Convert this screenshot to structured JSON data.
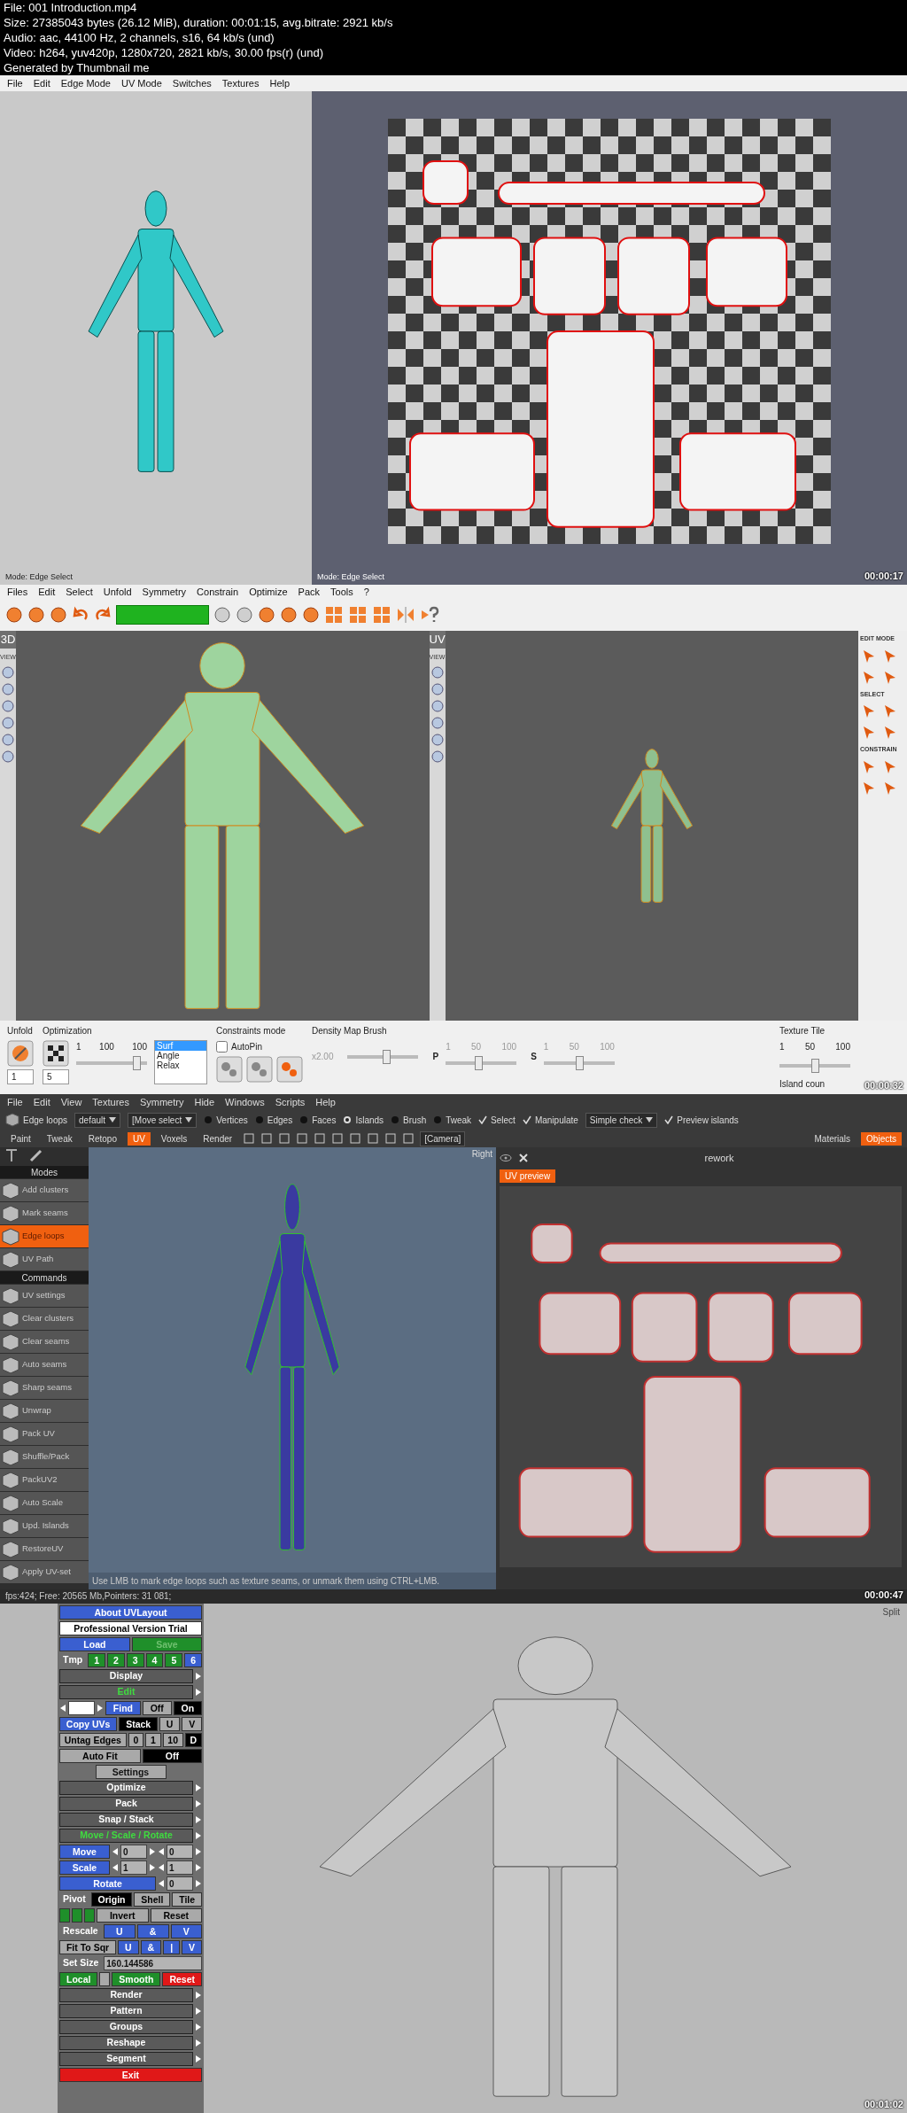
{
  "header": {
    "lines": [
      "File: 001 Introduction.mp4",
      "Size: 27385043 bytes (26.12 MiB), duration: 00:01:15, avg.bitrate: 2921 kb/s",
      "Audio: aac, 44100 Hz, 2 channels, s16, 64 kb/s (und)",
      "Video: h264, yuv420p, 1280x720, 2821 kb/s, 30.00 fps(r) (und)",
      "Generated by Thumbnail me"
    ]
  },
  "frame_1": {
    "menu": [
      "File",
      "Edit",
      "Edge Mode",
      "UV Mode",
      "Switches",
      "Textures",
      "Help"
    ],
    "left_status": "Mode: Edge Select",
    "right_status": "Mode: Edge Select",
    "timestamp": "00:00:17"
  },
  "frame_2": {
    "menu": [
      "Files",
      "Edit",
      "Select",
      "Unfold",
      "Symmetry",
      "Constrain",
      "Optimize",
      "Pack",
      "Tools",
      "?"
    ],
    "left_view": {
      "label": "3D",
      "sub": "VIEW"
    },
    "uv_view": {
      "label": "UV",
      "sub": "VIEW"
    },
    "tool_sections": [
      "EDIT MODE",
      "SELECT",
      "CONSTRAIN"
    ],
    "bottom": {
      "unfold": {
        "title": "Unfold",
        "spin": "1"
      },
      "optimization": {
        "title": "Optimization",
        "spin": "5",
        "scale": [
          "1",
          "100",
          "100"
        ],
        "level": 0.9,
        "list": [
          {
            "label": "Surf",
            "selected": true
          },
          {
            "label": "Angle",
            "selected": false
          },
          {
            "label": "Relax",
            "selected": false
          }
        ]
      },
      "constraints": {
        "title": "Constraints mode",
        "autopin": {
          "label": "AutoPin",
          "checked": false
        }
      },
      "density": {
        "title": "Density Map Brush",
        "reading": "x2.00",
        "level": 0.55,
        "p": {
          "label": "P",
          "scale": [
            "1",
            "50",
            "100"
          ],
          "level": 0.45
        },
        "s": {
          "label": "S",
          "scale": [
            "1",
            "50",
            "100"
          ],
          "level": 0.5
        }
      },
      "texture_tile": {
        "title": "Texture Tile",
        "scale": [
          "1",
          "50",
          "100"
        ],
        "level": 0.5,
        "island": "Island coun"
      }
    },
    "timestamp": "00:00:32"
  },
  "frame_3": {
    "menu": [
      "File",
      "Edit",
      "View",
      "Textures",
      "Symmetry",
      "Hide",
      "Windows",
      "Scripts",
      "Help"
    ],
    "toolrow": [
      {
        "kind": "tool",
        "label": "Edge loops"
      },
      {
        "kind": "dropdown",
        "label": "default"
      },
      {
        "kind": "dropdown",
        "label": "[Move select"
      },
      {
        "kind": "radio",
        "label": "Vertices",
        "selected": false
      },
      {
        "kind": "radio",
        "label": "Edges",
        "selected": false
      },
      {
        "kind": "radio",
        "label": "Faces",
        "selected": false
      },
      {
        "kind": "radio",
        "label": "Islands",
        "selected": true
      },
      {
        "kind": "radio",
        "label": "Brush",
        "selected": false
      },
      {
        "kind": "radio",
        "label": "Tweak",
        "selected": false
      },
      {
        "kind": "check",
        "label": "Select",
        "checked": true
      },
      {
        "kind": "check",
        "label": "Manipulate",
        "checked": true
      },
      {
        "kind": "dropdown",
        "label": "Simple check"
      },
      {
        "kind": "check",
        "label": "Preview islands",
        "checked": true
      }
    ],
    "rooms": [
      {
        "label": "Paint",
        "selected": false
      },
      {
        "label": "Tweak",
        "selected": false
      },
      {
        "label": "Retopo",
        "selected": false
      },
      {
        "label": "UV",
        "selected": true
      },
      {
        "label": "Voxels",
        "selected": false
      },
      {
        "label": "Render",
        "selected": false
      }
    ],
    "camera": "[Camera]",
    "panel_tabs": [
      {
        "label": "Materials",
        "selected": false
      },
      {
        "label": "Objects",
        "selected": true
      }
    ],
    "sections": [
      {
        "title": "Modes",
        "items": [
          {
            "label": "Add clusters",
            "selected": false
          },
          {
            "label": "Mark seams",
            "selected": false
          },
          {
            "label": "Edge loops",
            "selected": true
          },
          {
            "label": "UV Path",
            "selected": false
          }
        ]
      },
      {
        "title": "Commands",
        "items": [
          {
            "label": "UV settings",
            "selected": false
          },
          {
            "label": "Clear clusters",
            "selected": false
          },
          {
            "label": "Clear seams",
            "selected": false
          },
          {
            "label": "Auto seams",
            "selected": false
          },
          {
            "label": "Sharp seams",
            "selected": false
          },
          {
            "label": "Unwrap",
            "selected": false
          },
          {
            "label": "Pack UV",
            "selected": false
          },
          {
            "label": "Shuffle/Pack",
            "selected": false
          },
          {
            "label": "PackUV2",
            "selected": false
          },
          {
            "label": "Auto Scale",
            "selected": false
          },
          {
            "label": "Upd. Islands",
            "selected": false
          },
          {
            "label": "RestoreUV",
            "selected": false
          },
          {
            "label": "Apply UV-set",
            "selected": false
          }
        ]
      }
    ],
    "view_label": "Right",
    "hint": "Use LMB to mark edge loops such as texture seams, or unmark them using CTRL+LMB.",
    "object_name": "rework",
    "preview_tab": "UV preview",
    "status": "fps:424;  Free: 20565 Mb,Pointers: 31 081;",
    "timestamp": "00:00:47"
  },
  "frame_4": {
    "rows": [
      {
        "items": [
          {
            "kind": "button",
            "label": "About UVLayout",
            "color": "#3a5fd0"
          }
        ]
      },
      {
        "items": [
          {
            "kind": "button",
            "label": "Professional Version Trial",
            "color": "#ffffff"
          }
        ]
      },
      {
        "items": [
          {
            "kind": "button",
            "label": "Load",
            "color": "#3a5fd0",
            "disabled": false
          },
          {
            "kind": "button",
            "label": "Save",
            "color": "#1f8f2a",
            "disabled": true
          }
        ]
      },
      {
        "items": [
          {
            "kind": "text",
            "label": "Tmp"
          },
          {
            "kind": "button",
            "label": "1",
            "color": "#1f8f2a"
          },
          {
            "kind": "button",
            "label": "2",
            "color": "#1f8f2a"
          },
          {
            "kind": "button",
            "label": "3",
            "color": "#1f8f2a"
          },
          {
            "kind": "button",
            "label": "4",
            "color": "#1f8f2a"
          },
          {
            "kind": "button",
            "label": "5",
            "color": "#1f8f2a"
          },
          {
            "kind": "button",
            "label": "6",
            "color": "#3a5fd0"
          }
        ]
      },
      {
        "items": [
          {
            "kind": "menu",
            "label": "Display",
            "active": false
          }
        ]
      },
      {
        "items": [
          {
            "kind": "menu",
            "label": "Edit",
            "active": true
          }
        ]
      },
      {
        "items": [
          {
            "kind": "stepper"
          },
          {
            "kind": "button",
            "label": "Find",
            "color": "#3a5fd0"
          },
          {
            "kind": "button",
            "label": "Off",
            "color": "#a9a9a9"
          },
          {
            "kind": "button",
            "label": "On",
            "color": "#000000"
          }
        ]
      },
      {
        "items": [
          {
            "kind": "button",
            "label": "Copy UVs",
            "color": "#3a5fd0"
          },
          {
            "kind": "button",
            "label": "Stack",
            "color": "#000000"
          },
          {
            "kind": "button",
            "label": "U",
            "color": "#a9a9a9"
          },
          {
            "kind": "button",
            "label": "V",
            "color": "#a9a9a9"
          }
        ]
      },
      {
        "items": [
          {
            "kind": "button",
            "label": "Untag Edges",
            "color": "#a9a9a9"
          },
          {
            "kind": "button",
            "label": "0",
            "color": "#a9a9a9"
          },
          {
            "kind": "button",
            "label": "1",
            "color": "#a9a9a9"
          },
          {
            "kind": "button",
            "label": "10",
            "color": "#a9a9a9"
          },
          {
            "kind": "button",
            "label": "D",
            "color": "#000000"
          }
        ]
      },
      {
        "items": [
          {
            "kind": "button",
            "label": "Auto Fit",
            "color": "#a9a9a9"
          },
          {
            "kind": "button",
            "label": "Off",
            "color": "#000000"
          }
        ]
      },
      {
        "items": [
          {
            "kind": "section",
            "label": "Settings"
          }
        ]
      },
      {
        "items": [
          {
            "kind": "menu",
            "label": "Optimize",
            "active": false
          }
        ]
      },
      {
        "items": [
          {
            "kind": "menu",
            "label": "Pack",
            "active": false
          }
        ]
      },
      {
        "items": [
          {
            "kind": "menu",
            "label": "Snap / Stack",
            "active": false
          }
        ]
      },
      {
        "items": [
          {
            "kind": "menu",
            "label": "Move / Scale / Rotate",
            "active": true
          }
        ]
      },
      {
        "items": [
          {
            "kind": "button",
            "label": "Move",
            "color": "#3a5fd0"
          },
          {
            "kind": "stepper",
            "value": "0"
          },
          {
            "kind": "stepper",
            "value": "0"
          }
        ]
      },
      {
        "items": [
          {
            "kind": "button",
            "label": "Scale",
            "color": "#3a5fd0"
          },
          {
            "kind": "stepper",
            "value": "1"
          },
          {
            "kind": "stepper",
            "value": "1"
          }
        ]
      },
      {
        "items": [
          {
            "kind": "button",
            "label": "Rotate",
            "color": "#3a5fd0"
          },
          {
            "kind": "stepper",
            "value": "0"
          }
        ]
      },
      {
        "items": [
          {
            "kind": "text",
            "label": "Pivot"
          },
          {
            "kind": "button",
            "label": "Origin",
            "color": "#000000"
          },
          {
            "kind": "button",
            "label": "Shell",
            "color": "#a9a9a9"
          },
          {
            "kind": "button",
            "label": "Tile",
            "color": "#a9a9a9"
          }
        ]
      },
      {
        "items": [
          {
            "kind": "swatch",
            "color": "#1f8f2a"
          },
          {
            "kind": "swatch",
            "color": "#1f8f2a"
          },
          {
            "kind": "swatch",
            "color": "#1f8f2a"
          },
          {
            "kind": "button",
            "label": "Invert",
            "color": "#a9a9a9"
          },
          {
            "kind": "button",
            "label": "Reset",
            "color": "#a9a9a9"
          }
        ]
      },
      {
        "items": [
          {
            "kind": "text",
            "label": "Rescale"
          },
          {
            "kind": "button",
            "label": "U",
            "color": "#3a5fd0"
          },
          {
            "kind": "button",
            "label": "&",
            "color": "#3a5fd0"
          },
          {
            "kind": "button",
            "label": "V",
            "color": "#3a5fd0"
          }
        ]
      },
      {
        "items": [
          {
            "kind": "button",
            "label": "Fit To Sqr",
            "color": "#a9a9a9"
          },
          {
            "kind": "button",
            "label": "U",
            "color": "#3a5fd0"
          },
          {
            "kind": "button",
            "label": "&",
            "color": "#3a5fd0"
          },
          {
            "kind": "button",
            "label": "|",
            "color": "#3a5fd0"
          },
          {
            "kind": "button",
            "label": "V",
            "color": "#3a5fd0"
          }
        ]
      },
      {
        "items": [
          {
            "kind": "text",
            "label": "Set Size"
          },
          {
            "kind": "field",
            "value": "160.144586"
          }
        ]
      },
      {
        "items": [
          {
            "kind": "button",
            "label": "Local",
            "color": "#1f8f2a"
          },
          {
            "kind": "swatch",
            "color": "#a9a9a9"
          },
          {
            "kind": "button",
            "label": "Smooth",
            "color": "#1f8f2a"
          },
          {
            "kind": "button",
            "label": "Reset",
            "color": "#e01818"
          }
        ]
      },
      {
        "items": [
          {
            "kind": "menu",
            "label": "Render",
            "active": false
          }
        ]
      },
      {
        "items": [
          {
            "kind": "menu",
            "label": "Pattern",
            "active": false
          }
        ]
      },
      {
        "items": [
          {
            "kind": "menu",
            "label": "Groups",
            "active": false
          }
        ]
      },
      {
        "items": [
          {
            "kind": "menu",
            "label": "Reshape",
            "active": false
          }
        ]
      },
      {
        "items": [
          {
            "kind": "menu",
            "label": "Segment",
            "active": false
          }
        ]
      },
      {
        "items": [
          {
            "kind": "button",
            "label": "Exit",
            "color": "#e01818"
          }
        ]
      }
    ],
    "view_label": "Split",
    "timestamp": "00:01:02"
  }
}
